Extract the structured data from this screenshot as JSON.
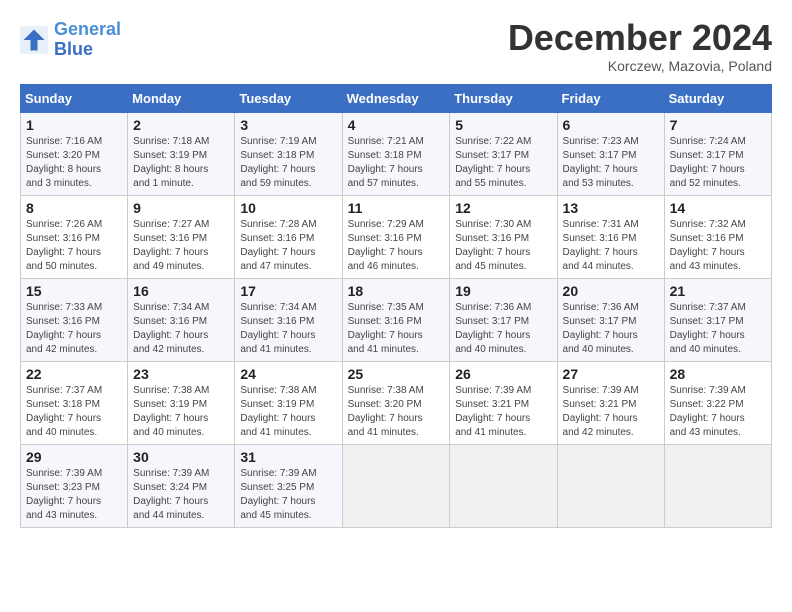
{
  "logo": {
    "line1": "General",
    "line2": "Blue"
  },
  "title": "December 2024",
  "subtitle": "Korczew, Mazovia, Poland",
  "days_of_week": [
    "Sunday",
    "Monday",
    "Tuesday",
    "Wednesday",
    "Thursday",
    "Friday",
    "Saturday"
  ],
  "weeks": [
    [
      {
        "day": "1",
        "info": "Sunrise: 7:16 AM\nSunset: 3:20 PM\nDaylight: 8 hours\nand 3 minutes."
      },
      {
        "day": "2",
        "info": "Sunrise: 7:18 AM\nSunset: 3:19 PM\nDaylight: 8 hours\nand 1 minute."
      },
      {
        "day": "3",
        "info": "Sunrise: 7:19 AM\nSunset: 3:18 PM\nDaylight: 7 hours\nand 59 minutes."
      },
      {
        "day": "4",
        "info": "Sunrise: 7:21 AM\nSunset: 3:18 PM\nDaylight: 7 hours\nand 57 minutes."
      },
      {
        "day": "5",
        "info": "Sunrise: 7:22 AM\nSunset: 3:17 PM\nDaylight: 7 hours\nand 55 minutes."
      },
      {
        "day": "6",
        "info": "Sunrise: 7:23 AM\nSunset: 3:17 PM\nDaylight: 7 hours\nand 53 minutes."
      },
      {
        "day": "7",
        "info": "Sunrise: 7:24 AM\nSunset: 3:17 PM\nDaylight: 7 hours\nand 52 minutes."
      }
    ],
    [
      {
        "day": "8",
        "info": "Sunrise: 7:26 AM\nSunset: 3:16 PM\nDaylight: 7 hours\nand 50 minutes."
      },
      {
        "day": "9",
        "info": "Sunrise: 7:27 AM\nSunset: 3:16 PM\nDaylight: 7 hours\nand 49 minutes."
      },
      {
        "day": "10",
        "info": "Sunrise: 7:28 AM\nSunset: 3:16 PM\nDaylight: 7 hours\nand 47 minutes."
      },
      {
        "day": "11",
        "info": "Sunrise: 7:29 AM\nSunset: 3:16 PM\nDaylight: 7 hours\nand 46 minutes."
      },
      {
        "day": "12",
        "info": "Sunrise: 7:30 AM\nSunset: 3:16 PM\nDaylight: 7 hours\nand 45 minutes."
      },
      {
        "day": "13",
        "info": "Sunrise: 7:31 AM\nSunset: 3:16 PM\nDaylight: 7 hours\nand 44 minutes."
      },
      {
        "day": "14",
        "info": "Sunrise: 7:32 AM\nSunset: 3:16 PM\nDaylight: 7 hours\nand 43 minutes."
      }
    ],
    [
      {
        "day": "15",
        "info": "Sunrise: 7:33 AM\nSunset: 3:16 PM\nDaylight: 7 hours\nand 42 minutes."
      },
      {
        "day": "16",
        "info": "Sunrise: 7:34 AM\nSunset: 3:16 PM\nDaylight: 7 hours\nand 42 minutes."
      },
      {
        "day": "17",
        "info": "Sunrise: 7:34 AM\nSunset: 3:16 PM\nDaylight: 7 hours\nand 41 minutes."
      },
      {
        "day": "18",
        "info": "Sunrise: 7:35 AM\nSunset: 3:16 PM\nDaylight: 7 hours\nand 41 minutes."
      },
      {
        "day": "19",
        "info": "Sunrise: 7:36 AM\nSunset: 3:17 PM\nDaylight: 7 hours\nand 40 minutes."
      },
      {
        "day": "20",
        "info": "Sunrise: 7:36 AM\nSunset: 3:17 PM\nDaylight: 7 hours\nand 40 minutes."
      },
      {
        "day": "21",
        "info": "Sunrise: 7:37 AM\nSunset: 3:17 PM\nDaylight: 7 hours\nand 40 minutes."
      }
    ],
    [
      {
        "day": "22",
        "info": "Sunrise: 7:37 AM\nSunset: 3:18 PM\nDaylight: 7 hours\nand 40 minutes."
      },
      {
        "day": "23",
        "info": "Sunrise: 7:38 AM\nSunset: 3:19 PM\nDaylight: 7 hours\nand 40 minutes."
      },
      {
        "day": "24",
        "info": "Sunrise: 7:38 AM\nSunset: 3:19 PM\nDaylight: 7 hours\nand 41 minutes."
      },
      {
        "day": "25",
        "info": "Sunrise: 7:38 AM\nSunset: 3:20 PM\nDaylight: 7 hours\nand 41 minutes."
      },
      {
        "day": "26",
        "info": "Sunrise: 7:39 AM\nSunset: 3:21 PM\nDaylight: 7 hours\nand 41 minutes."
      },
      {
        "day": "27",
        "info": "Sunrise: 7:39 AM\nSunset: 3:21 PM\nDaylight: 7 hours\nand 42 minutes."
      },
      {
        "day": "28",
        "info": "Sunrise: 7:39 AM\nSunset: 3:22 PM\nDaylight: 7 hours\nand 43 minutes."
      }
    ],
    [
      {
        "day": "29",
        "info": "Sunrise: 7:39 AM\nSunset: 3:23 PM\nDaylight: 7 hours\nand 43 minutes."
      },
      {
        "day": "30",
        "info": "Sunrise: 7:39 AM\nSunset: 3:24 PM\nDaylight: 7 hours\nand 44 minutes."
      },
      {
        "day": "31",
        "info": "Sunrise: 7:39 AM\nSunset: 3:25 PM\nDaylight: 7 hours\nand 45 minutes."
      },
      {
        "day": "",
        "info": ""
      },
      {
        "day": "",
        "info": ""
      },
      {
        "day": "",
        "info": ""
      },
      {
        "day": "",
        "info": ""
      }
    ]
  ]
}
